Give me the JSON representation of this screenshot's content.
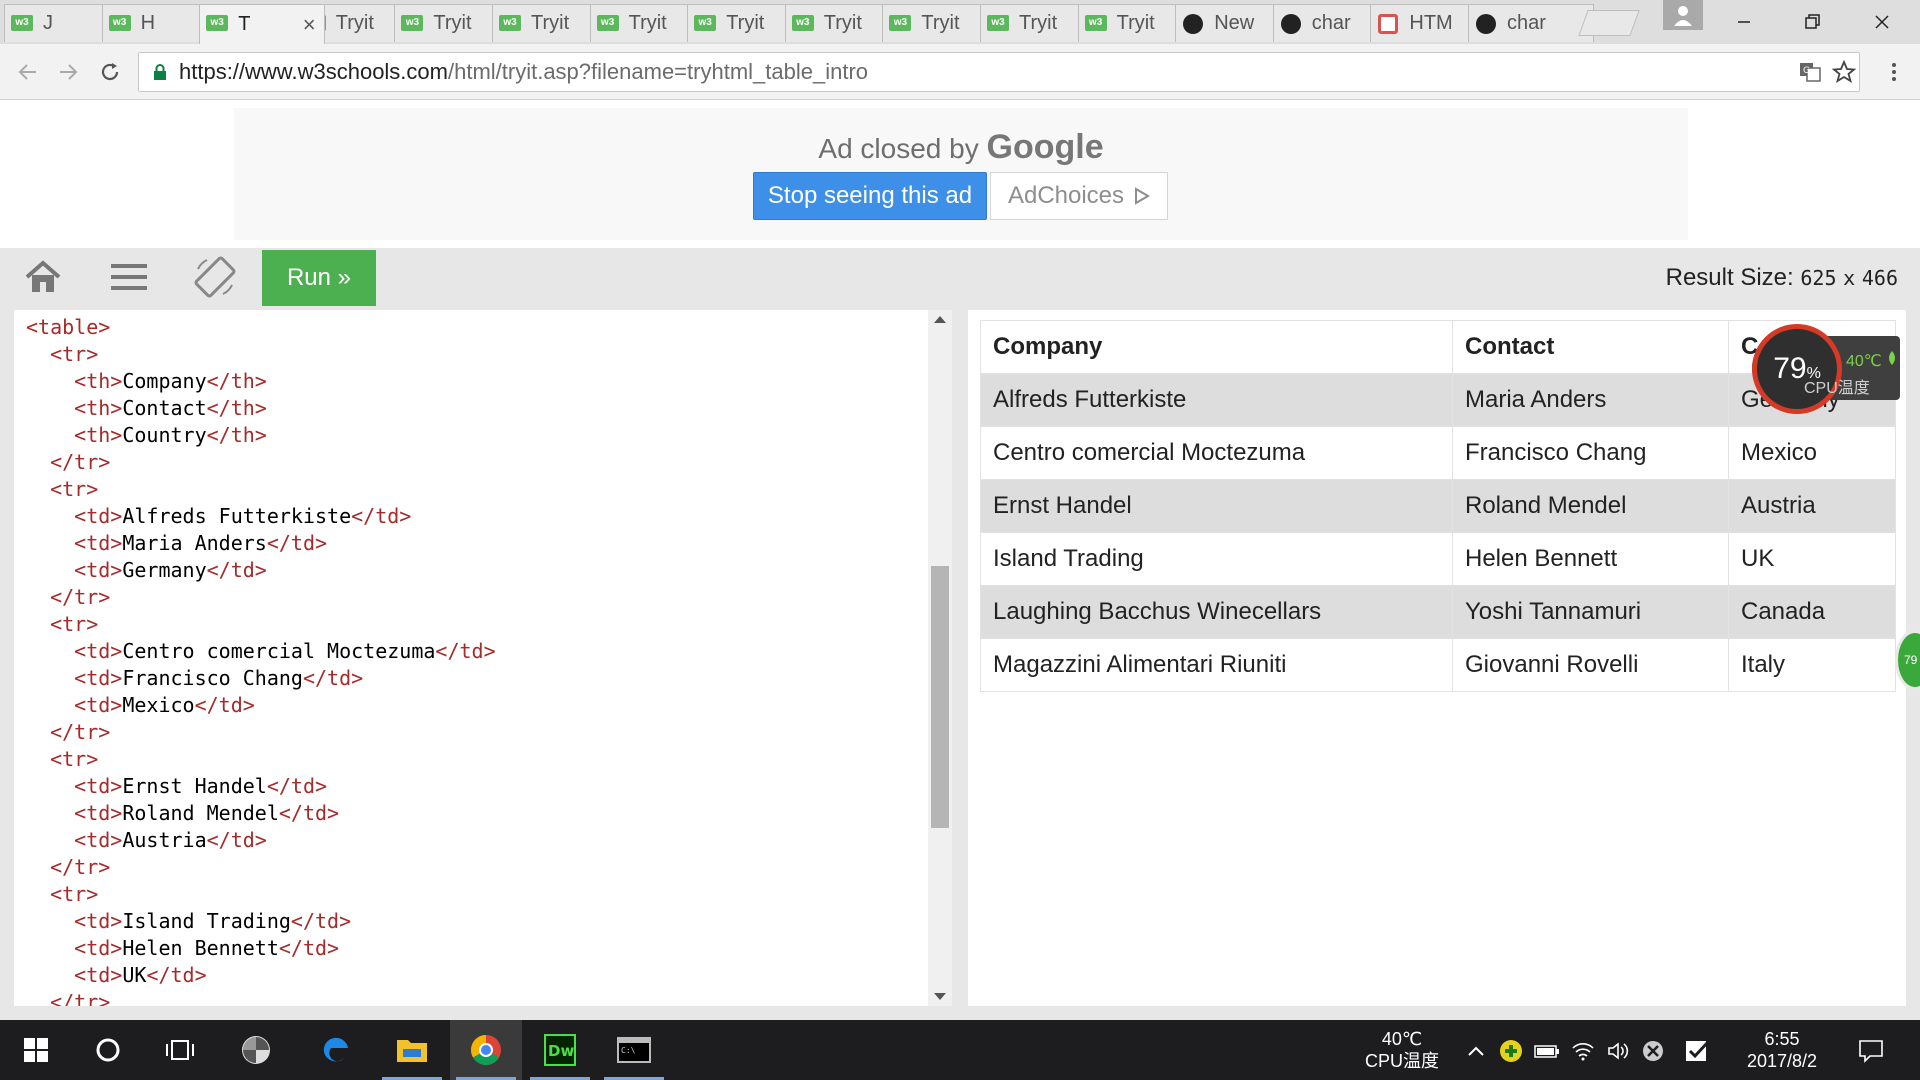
{
  "browser": {
    "tabs": [
      {
        "label": "J",
        "icon": "w3-favicon-icon",
        "closable": true
      },
      {
        "label": "H",
        "icon": "w3-favicon-icon",
        "closable": true
      },
      {
        "label": "T",
        "icon": "w3-favicon-icon",
        "closable": true,
        "active": true
      },
      {
        "label": "Tryit",
        "icon": "w3-favicon-icon"
      },
      {
        "label": "Tryit",
        "icon": "w3-favicon-icon"
      },
      {
        "label": "Tryit",
        "icon": "w3-favicon-icon"
      },
      {
        "label": "Tryit",
        "icon": "w3-favicon-icon"
      },
      {
        "label": "Tryit",
        "icon": "w3-favicon-icon"
      },
      {
        "label": "Tryit",
        "icon": "w3-favicon-icon"
      },
      {
        "label": "Tryit",
        "icon": "w3-favicon-icon"
      },
      {
        "label": "Tryit",
        "icon": "w3-favicon-icon"
      },
      {
        "label": "Tryit",
        "icon": "w3-favicon-icon"
      },
      {
        "label": "New",
        "icon": "github-icon"
      },
      {
        "label": "char",
        "icon": "github-icon"
      },
      {
        "label": "HTM",
        "icon": "html5-icon"
      },
      {
        "label": "char",
        "icon": "github-icon"
      }
    ],
    "url_host": "https://www.w3schools.com",
    "url_path": "/html/tryit.asp?filename=tryhtml_table_intro"
  },
  "ad": {
    "closed_text": "Ad closed by",
    "google_text": "Google",
    "stop_label": "Stop seeing this ad",
    "adchoices_label": "AdChoices"
  },
  "tryit": {
    "run_label": "Run »",
    "result_size_label": "Result Size:",
    "result_width": "625",
    "result_x": "x",
    "result_height": "466"
  },
  "editor": {
    "lines": [
      {
        "indent": 0,
        "parts": [
          {
            "t": "<table>",
            "tag": true
          }
        ]
      },
      {
        "indent": 1,
        "parts": [
          {
            "t": "<tr>",
            "tag": true
          }
        ]
      },
      {
        "indent": 2,
        "parts": [
          {
            "t": "<th>",
            "tag": true
          },
          {
            "t": "Company"
          },
          {
            "t": "</th>",
            "tag": true
          }
        ]
      },
      {
        "indent": 2,
        "parts": [
          {
            "t": "<th>",
            "tag": true
          },
          {
            "t": "Contact"
          },
          {
            "t": "</th>",
            "tag": true
          }
        ]
      },
      {
        "indent": 2,
        "parts": [
          {
            "t": "<th>",
            "tag": true
          },
          {
            "t": "Country"
          },
          {
            "t": "</th>",
            "tag": true
          }
        ]
      },
      {
        "indent": 1,
        "parts": [
          {
            "t": "</tr>",
            "tag": true
          }
        ]
      },
      {
        "indent": 1,
        "parts": [
          {
            "t": "<tr>",
            "tag": true
          }
        ]
      },
      {
        "indent": 2,
        "parts": [
          {
            "t": "<td>",
            "tag": true
          },
          {
            "t": "Alfreds Futterkiste"
          },
          {
            "t": "</td>",
            "tag": true
          }
        ]
      },
      {
        "indent": 2,
        "parts": [
          {
            "t": "<td>",
            "tag": true
          },
          {
            "t": "Maria Anders"
          },
          {
            "t": "</td>",
            "tag": true
          }
        ]
      },
      {
        "indent": 2,
        "parts": [
          {
            "t": "<td>",
            "tag": true
          },
          {
            "t": "Germany"
          },
          {
            "t": "</td>",
            "tag": true
          }
        ]
      },
      {
        "indent": 1,
        "parts": [
          {
            "t": "</tr>",
            "tag": true
          }
        ]
      },
      {
        "indent": 1,
        "parts": [
          {
            "t": "<tr>",
            "tag": true
          }
        ]
      },
      {
        "indent": 2,
        "parts": [
          {
            "t": "<td>",
            "tag": true
          },
          {
            "t": "Centro comercial Moctezuma"
          },
          {
            "t": "</td>",
            "tag": true
          }
        ]
      },
      {
        "indent": 2,
        "parts": [
          {
            "t": "<td>",
            "tag": true
          },
          {
            "t": "Francisco Chang"
          },
          {
            "t": "</td>",
            "tag": true
          }
        ]
      },
      {
        "indent": 2,
        "parts": [
          {
            "t": "<td>",
            "tag": true
          },
          {
            "t": "Mexico"
          },
          {
            "t": "</td>",
            "tag": true
          }
        ]
      },
      {
        "indent": 1,
        "parts": [
          {
            "t": "</tr>",
            "tag": true
          }
        ]
      },
      {
        "indent": 1,
        "parts": [
          {
            "t": "<tr>",
            "tag": true
          }
        ]
      },
      {
        "indent": 2,
        "parts": [
          {
            "t": "<td>",
            "tag": true
          },
          {
            "t": "Ernst Handel"
          },
          {
            "t": "</td>",
            "tag": true
          }
        ]
      },
      {
        "indent": 2,
        "parts": [
          {
            "t": "<td>",
            "tag": true
          },
          {
            "t": "Roland Mendel"
          },
          {
            "t": "</td>",
            "tag": true
          }
        ]
      },
      {
        "indent": 2,
        "parts": [
          {
            "t": "<td>",
            "tag": true
          },
          {
            "t": "Austria"
          },
          {
            "t": "</td>",
            "tag": true
          }
        ]
      },
      {
        "indent": 1,
        "parts": [
          {
            "t": "</tr>",
            "tag": true
          }
        ]
      },
      {
        "indent": 1,
        "parts": [
          {
            "t": "<tr>",
            "tag": true
          }
        ]
      },
      {
        "indent": 2,
        "parts": [
          {
            "t": "<td>",
            "tag": true
          },
          {
            "t": "Island Trading"
          },
          {
            "t": "</td>",
            "tag": true
          }
        ]
      },
      {
        "indent": 2,
        "parts": [
          {
            "t": "<td>",
            "tag": true
          },
          {
            "t": "Helen Bennett"
          },
          {
            "t": "</td>",
            "tag": true
          }
        ]
      },
      {
        "indent": 2,
        "parts": [
          {
            "t": "<td>",
            "tag": true
          },
          {
            "t": "UK"
          },
          {
            "t": "</td>",
            "tag": true
          }
        ]
      },
      {
        "indent": 1,
        "parts": [
          {
            "t": "</tr>",
            "tag": true
          }
        ]
      }
    ]
  },
  "result_table": {
    "headers": [
      "Company",
      "Contact",
      "Country"
    ],
    "rows": [
      [
        "Alfreds Futterkiste",
        "Maria Anders",
        "Germany"
      ],
      [
        "Centro comercial Moctezuma",
        "Francisco Chang",
        "Mexico"
      ],
      [
        "Ernst Handel",
        "Roland Mendel",
        "Austria"
      ],
      [
        "Island Trading",
        "Helen Bennett",
        "UK"
      ],
      [
        "Laughing Bacchus Winecellars",
        "Yoshi Tannamuri",
        "Canada"
      ],
      [
        "Magazzini Alimentari Riuniti",
        "Giovanni Rovelli",
        "Italy"
      ]
    ]
  },
  "cpu_widget": {
    "percent": "79",
    "percent_unit": "%",
    "temp": "40℃",
    "label": "CPU温度",
    "side_value": "79"
  },
  "taskbar": {
    "tray_temp": "40℃",
    "tray_label": "CPU温度",
    "time": "6:55",
    "date": "2017/8/2"
  },
  "colors": {
    "run_green": "#4caf50",
    "stop_ad_blue": "#3d8fe8",
    "code_tag": "#a52a2a",
    "odd_row": "#dddddd"
  }
}
